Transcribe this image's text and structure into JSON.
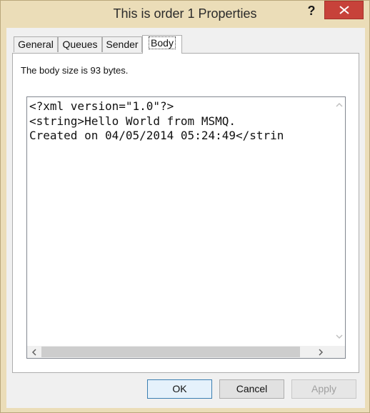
{
  "window": {
    "title": "This is order 1 Properties",
    "help_label": "?",
    "close_icon": "close-icon"
  },
  "tabs": [
    {
      "label": "General",
      "active": false
    },
    {
      "label": "Queues",
      "active": false
    },
    {
      "label": "Sender",
      "active": false
    },
    {
      "label": "Body",
      "active": true
    }
  ],
  "body": {
    "size_text": "The body size is 93 bytes.",
    "content_lines": [
      "<?xml version=\"1.0\"?>",
      "<string>Hello World from MSMQ.",
      "Created on 04/05/2014 05:24:49</strin"
    ]
  },
  "buttons": {
    "ok": "OK",
    "cancel": "Cancel",
    "apply": "Apply"
  },
  "colors": {
    "frame": "#ebddb8",
    "close_button": "#c7423a",
    "default_button_border": "#3c7fb1"
  }
}
